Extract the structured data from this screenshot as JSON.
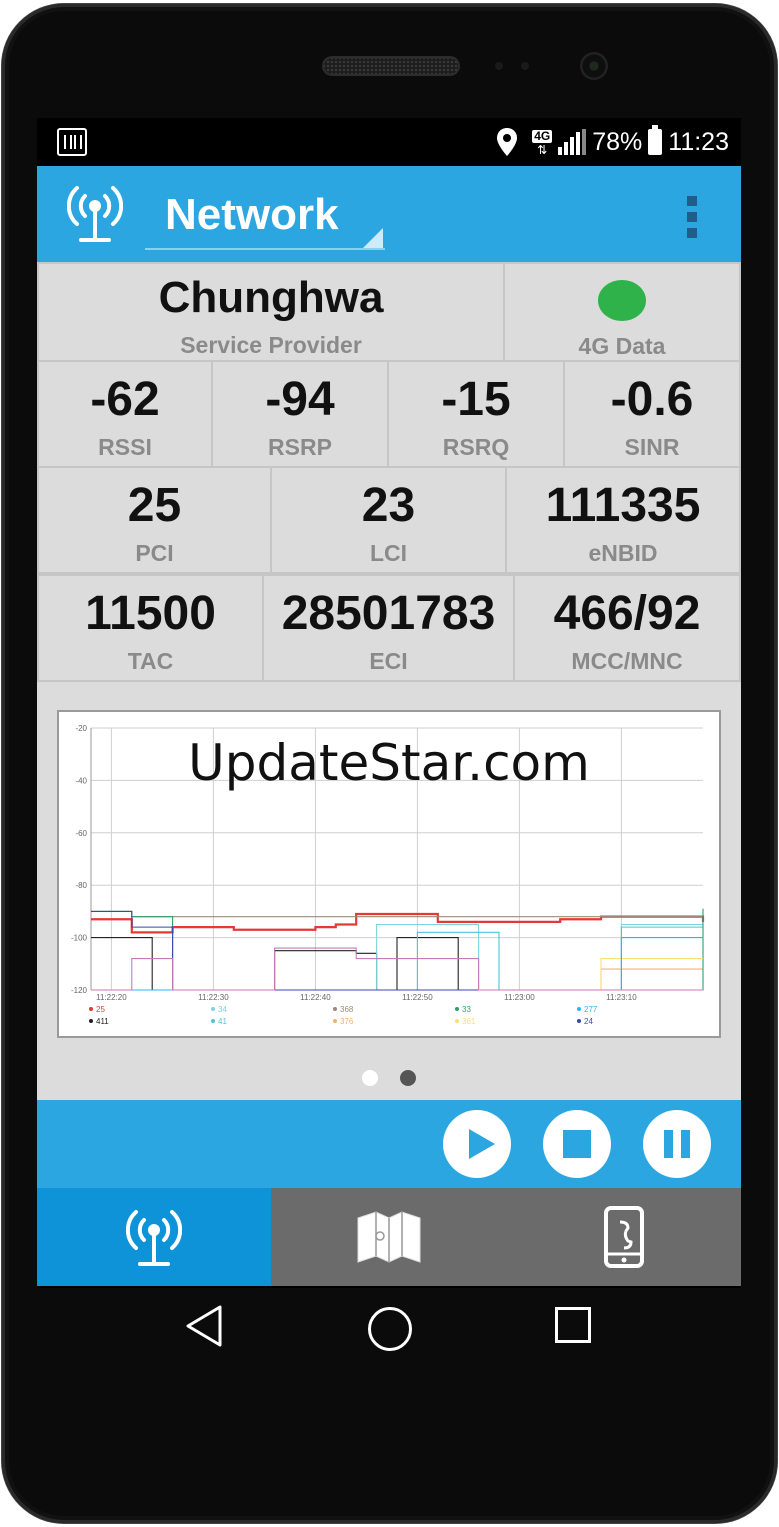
{
  "status_bar": {
    "battery_percent": "78%",
    "time": "11:23",
    "network_badge": "4G",
    "icons": [
      "sim-manager-icon",
      "location-pin-icon",
      "lte-data-icon",
      "signal-strength-icon",
      "battery-icon"
    ]
  },
  "app_bar": {
    "title": "Network",
    "logo_icon": "antenna-tower-icon",
    "menu_icon": "overflow-menu-icon",
    "accent_color": "#2ca6e0"
  },
  "provider": {
    "value": "Chunghwa",
    "label": "Service Provider"
  },
  "data_status": {
    "label": "4G Data",
    "indicator_color": "#2fb24a"
  },
  "signal_metrics": [
    {
      "value": "-62",
      "label": "RSSI"
    },
    {
      "value": "-94",
      "label": "RSRP"
    },
    {
      "value": "-15",
      "label": "RSRQ"
    },
    {
      "value": "-0.6",
      "label": "SINR"
    }
  ],
  "cell_ids": [
    {
      "value": "25",
      "label": "PCI"
    },
    {
      "value": "23",
      "label": "LCI"
    },
    {
      "value": "111335",
      "label": "eNBID"
    }
  ],
  "network_ids": [
    {
      "value": "11500",
      "label": "TAC"
    },
    {
      "value": "28501783",
      "label": "ECI"
    },
    {
      "value": "466/92",
      "label": "MCC/MNC"
    }
  ],
  "watermark": "UpdateStar.com",
  "chart_data": {
    "type": "line",
    "ylim": [
      -120,
      -20
    ],
    "y_ticks": [
      "-20",
      "-40",
      "-60",
      "-80",
      "-100",
      "-120"
    ],
    "x_ticks": [
      "11:22:20",
      "11:22:30",
      "11:22:40",
      "11:22:50",
      "11:23:00",
      "11:23:10"
    ],
    "grid": true,
    "legend_position": "bottom",
    "series": [
      {
        "name": "25",
        "color": "#e53935",
        "x": [
          0,
          2,
          4,
          6,
          8,
          10,
          12,
          14,
          16,
          18,
          20,
          22,
          24,
          26,
          28,
          30,
          32,
          34,
          36,
          38,
          40,
          42,
          44,
          46,
          48,
          50,
          52,
          54,
          56,
          58,
          60
        ],
        "values": [
          -93,
          -93,
          -98,
          -98,
          -96,
          -96,
          -96,
          -97,
          -97,
          -97,
          -97,
          -96,
          -95,
          -91,
          -91,
          -91,
          -91,
          -94,
          -94,
          -94,
          -94,
          -94,
          -94,
          -93,
          -93,
          -92,
          -92,
          -92,
          -92,
          -92,
          -94
        ]
      },
      {
        "name": "411",
        "color": "#222222",
        "x": [
          0,
          2,
          4,
          6,
          8,
          10,
          12,
          14,
          16,
          18,
          20,
          22,
          24,
          26,
          28,
          30,
          32,
          34,
          36,
          38,
          40,
          42,
          44,
          46,
          48,
          50,
          52,
          54,
          56,
          58,
          60
        ],
        "values": [
          -100,
          -100,
          -100,
          -120,
          -120,
          -120,
          -120,
          -120,
          -120,
          -105,
          -105,
          -105,
          -105,
          -106,
          -120,
          -100,
          -100,
          -100,
          -120,
          -120,
          -120,
          -120,
          -120,
          -120,
          -120,
          -120,
          -120,
          -120,
          -120,
          -120,
          -120
        ]
      },
      {
        "name": "34",
        "color": "#7ed3e0",
        "x": [
          0,
          2,
          4,
          6,
          8,
          10,
          12,
          14,
          16,
          18,
          20,
          22,
          24,
          26,
          28,
          30,
          32,
          34,
          36,
          38,
          40,
          42,
          44,
          46,
          48,
          50,
          52,
          54,
          56,
          58,
          60
        ],
        "values": [
          -120,
          -120,
          -120,
          -120,
          -120,
          -120,
          -120,
          -120,
          -120,
          -120,
          -120,
          -120,
          -120,
          -120,
          -95,
          -95,
          -95,
          -95,
          -95,
          -120,
          -120,
          -120,
          -120,
          -120,
          -120,
          -120,
          -95,
          -95,
          -95,
          -95,
          -95
        ]
      },
      {
        "name": "41",
        "color": "#4fc3d8",
        "x": [
          0,
          2,
          4,
          6,
          8,
          10,
          12,
          14,
          16,
          18,
          20,
          22,
          24,
          26,
          28,
          30,
          32,
          34,
          36,
          38,
          40,
          42,
          44,
          46,
          48,
          50,
          52,
          54,
          56,
          58,
          60
        ],
        "values": [
          -120,
          -120,
          -120,
          -120,
          -120,
          -120,
          -120,
          -120,
          -120,
          -120,
          -120,
          -120,
          -120,
          -120,
          -120,
          -120,
          -98,
          -98,
          -98,
          -98,
          -120,
          -120,
          -120,
          -120,
          -120,
          -120,
          -96,
          -96,
          -96,
          -96,
          -96
        ]
      },
      {
        "name": "368",
        "color": "#9a8b7a",
        "x": [
          0,
          2,
          4,
          6,
          8,
          10,
          12,
          14,
          16,
          18,
          20,
          22,
          24,
          26,
          28,
          30,
          32,
          34,
          36,
          38,
          40,
          42,
          44,
          46,
          48,
          50,
          52,
          54,
          56,
          58,
          60
        ],
        "values": [
          -90,
          -90,
          -92,
          -92,
          -92,
          -92,
          -92,
          -92,
          -92,
          -92,
          -92,
          -92,
          -92,
          -92,
          -92,
          -92,
          -92,
          -92,
          -92,
          -92,
          -92,
          -92,
          -92,
          -92,
          -92,
          -92,
          -92,
          -92,
          -92,
          -92,
          -92
        ]
      },
      {
        "name": "376",
        "color": "#f6b26b",
        "x": [
          0,
          2,
          4,
          6,
          8,
          10,
          12,
          14,
          16,
          18,
          20,
          22,
          24,
          26,
          28,
          30,
          32,
          34,
          36,
          38,
          40,
          42,
          44,
          46,
          48,
          50,
          52,
          54,
          56,
          58,
          60
        ],
        "values": [
          -120,
          -120,
          -120,
          -120,
          -120,
          -120,
          -120,
          -120,
          -120,
          -120,
          -120,
          -120,
          -120,
          -120,
          -120,
          -120,
          -120,
          -120,
          -120,
          -120,
          -120,
          -120,
          -120,
          -120,
          -120,
          -112,
          -112,
          -112,
          -112,
          -112,
          -112
        ]
      },
      {
        "name": "33",
        "color": "#2e9e6e",
        "x": [
          0,
          2,
          4,
          6,
          8,
          10,
          12,
          14,
          16,
          18,
          20,
          22,
          24,
          26,
          28,
          30,
          32,
          34,
          36,
          38,
          40,
          42,
          44,
          46,
          48,
          50,
          52,
          54,
          56,
          58,
          60
        ],
        "values": [
          -90,
          -90,
          -92,
          -92,
          -120,
          -120,
          -120,
          -120,
          -120,
          -120,
          -120,
          -120,
          -120,
          -120,
          -120,
          -120,
          -120,
          -120,
          -120,
          -120,
          -120,
          -120,
          -120,
          -120,
          -120,
          -120,
          -120,
          -120,
          -120,
          -120,
          -89
        ]
      },
      {
        "name": "361",
        "color": "#f7e26b",
        "x": [
          0,
          2,
          4,
          6,
          8,
          10,
          12,
          14,
          16,
          18,
          20,
          22,
          24,
          26,
          28,
          30,
          32,
          34,
          36,
          38,
          40,
          42,
          44,
          46,
          48,
          50,
          52,
          54,
          56,
          58,
          60
        ],
        "values": [
          -120,
          -120,
          -120,
          -120,
          -120,
          -120,
          -120,
          -120,
          -120,
          -120,
          -120,
          -120,
          -120,
          -120,
          -120,
          -120,
          -120,
          -120,
          -120,
          -120,
          -120,
          -120,
          -120,
          -120,
          -120,
          -108,
          -108,
          -108,
          -108,
          -108,
          -108
        ]
      },
      {
        "name": "277",
        "color": "#29b6f6",
        "x": [
          0,
          2,
          4,
          6,
          8,
          10,
          12,
          14,
          16,
          18,
          20,
          22,
          24,
          26,
          28,
          30,
          32,
          34,
          36,
          38,
          40,
          42,
          44,
          46,
          48,
          50,
          52,
          54,
          56,
          58,
          60
        ],
        "values": [
          -120,
          -120,
          -120,
          -120,
          -120,
          -120,
          -120,
          -120,
          -120,
          -120,
          -120,
          -120,
          -120,
          -120,
          -120,
          -120,
          -120,
          -120,
          -120,
          -120,
          -120,
          -120,
          -120,
          -120,
          -120,
          -120,
          -100,
          -100,
          -100,
          -100,
          -100
        ]
      },
      {
        "name": "24",
        "color": "#3949ab",
        "x": [
          0,
          2,
          4,
          6,
          8,
          10,
          12,
          14,
          16,
          18,
          20,
          22,
          24,
          26,
          28,
          30,
          32,
          34,
          36,
          38,
          40,
          42,
          44,
          46,
          48,
          50,
          52,
          54,
          56,
          58,
          60
        ],
        "values": [
          -90,
          -90,
          -96,
          -96,
          -120,
          -120,
          -120,
          -120,
          -120,
          -120,
          -120,
          -120,
          -120,
          -120,
          -120,
          -120,
          -120,
          -120,
          -120,
          -120,
          -120,
          -120,
          -120,
          -120,
          -120,
          -120,
          -120,
          -120,
          -120,
          -120,
          -120
        ]
      },
      {
        "name": "",
        "color": "#c77ab8",
        "x": [
          0,
          2,
          4,
          6,
          8,
          10,
          12,
          14,
          16,
          18,
          20,
          22,
          24,
          26,
          28,
          30,
          32,
          34,
          36,
          38,
          40,
          42,
          44,
          46,
          48,
          50,
          52,
          54,
          56,
          58,
          60
        ],
        "values": [
          -120,
          -120,
          -108,
          -108,
          -120,
          -120,
          -120,
          -120,
          -120,
          -104,
          -104,
          -104,
          -104,
          -108,
          -108,
          -108,
          -108,
          -108,
          -108,
          -120,
          -120,
          -120,
          -120,
          -120,
          -120,
          -120,
          -120,
          -120,
          -120,
          -120,
          -120
        ]
      }
    ]
  },
  "pager": {
    "count": 2,
    "active": 1
  },
  "controls": {
    "play_icon": "play-icon",
    "stop_icon": "stop-icon",
    "pause_icon": "pause-icon"
  },
  "bottom_nav": [
    {
      "icon": "antenna-tower-icon",
      "active": true
    },
    {
      "icon": "map-icon",
      "active": false
    },
    {
      "icon": "phone-icon",
      "active": false
    }
  ],
  "system_nav": {
    "back_icon": "back-triangle-icon",
    "home_icon": "home-circle-icon",
    "recents_icon": "recents-square-icon"
  }
}
